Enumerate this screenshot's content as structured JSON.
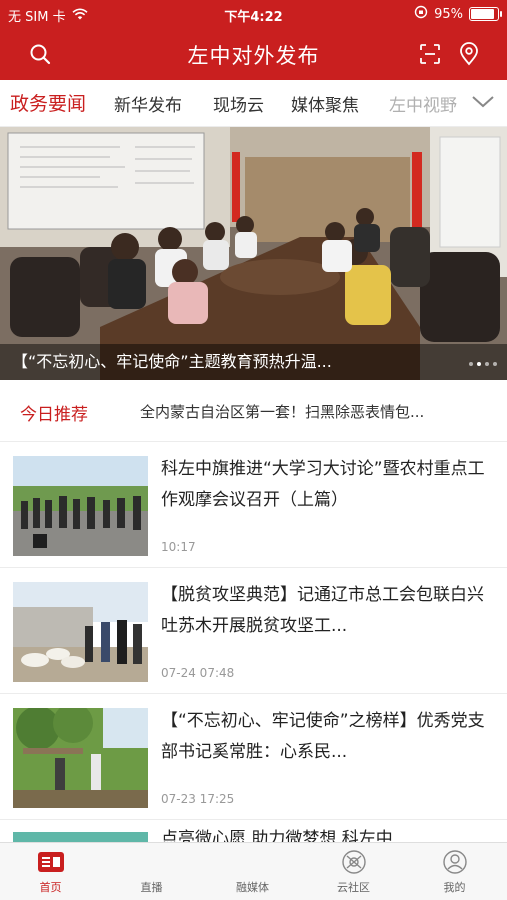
{
  "status_bar": {
    "carrier": "无 SIM 卡",
    "time": "下午4:22",
    "battery_percent": "95%",
    "battery_level": 0.95
  },
  "header": {
    "title": "左中对外发布",
    "icons": [
      "search-icon",
      "scan-icon",
      "location-pin-icon"
    ]
  },
  "tabs": [
    {
      "label": "政务要闻",
      "active": true
    },
    {
      "label": "新华发布"
    },
    {
      "label": "现场云"
    },
    {
      "label": "媒体聚焦"
    },
    {
      "label": "左中视野"
    }
  ],
  "hero": {
    "caption": "【“不忘初心、牢记使命”主题教育预热升温...",
    "slide_count": 4,
    "active_slide": 1
  },
  "recommend": {
    "label": "今日推荐",
    "text": "全内蒙古自治区第一套！扫黑除恶表情包..."
  },
  "news": [
    {
      "title": "科左中旗推进“大学习大讨论”暨农村重点工作观摩会议召开（上篇）",
      "time": "10:17"
    },
    {
      "title": "【脱贫攻坚典范】记通辽市总工会包联白兴吐苏木开展脱贫攻坚工...",
      "time": "07-24 07:48"
    },
    {
      "title": "【“不忘初心、牢记使命”之榜样】优秀党支部书记奚常胜：心系民...",
      "time": "07-23 17:25"
    },
    {
      "title": "点亮微心愿 助力微梦想 科左中"
    }
  ],
  "bottom_nav": [
    {
      "label": "首页",
      "icon": "home-icon",
      "active": true
    },
    {
      "label": "直播",
      "icon": "live-icon"
    },
    {
      "label": "融媒体",
      "icon": "media-icon"
    },
    {
      "label": "云社区",
      "icon": "community-icon"
    },
    {
      "label": "我的",
      "icon": "profile-icon"
    }
  ],
  "colors": {
    "brand_red": "#c91f1f",
    "nav_background": "#f7f7f7"
  }
}
